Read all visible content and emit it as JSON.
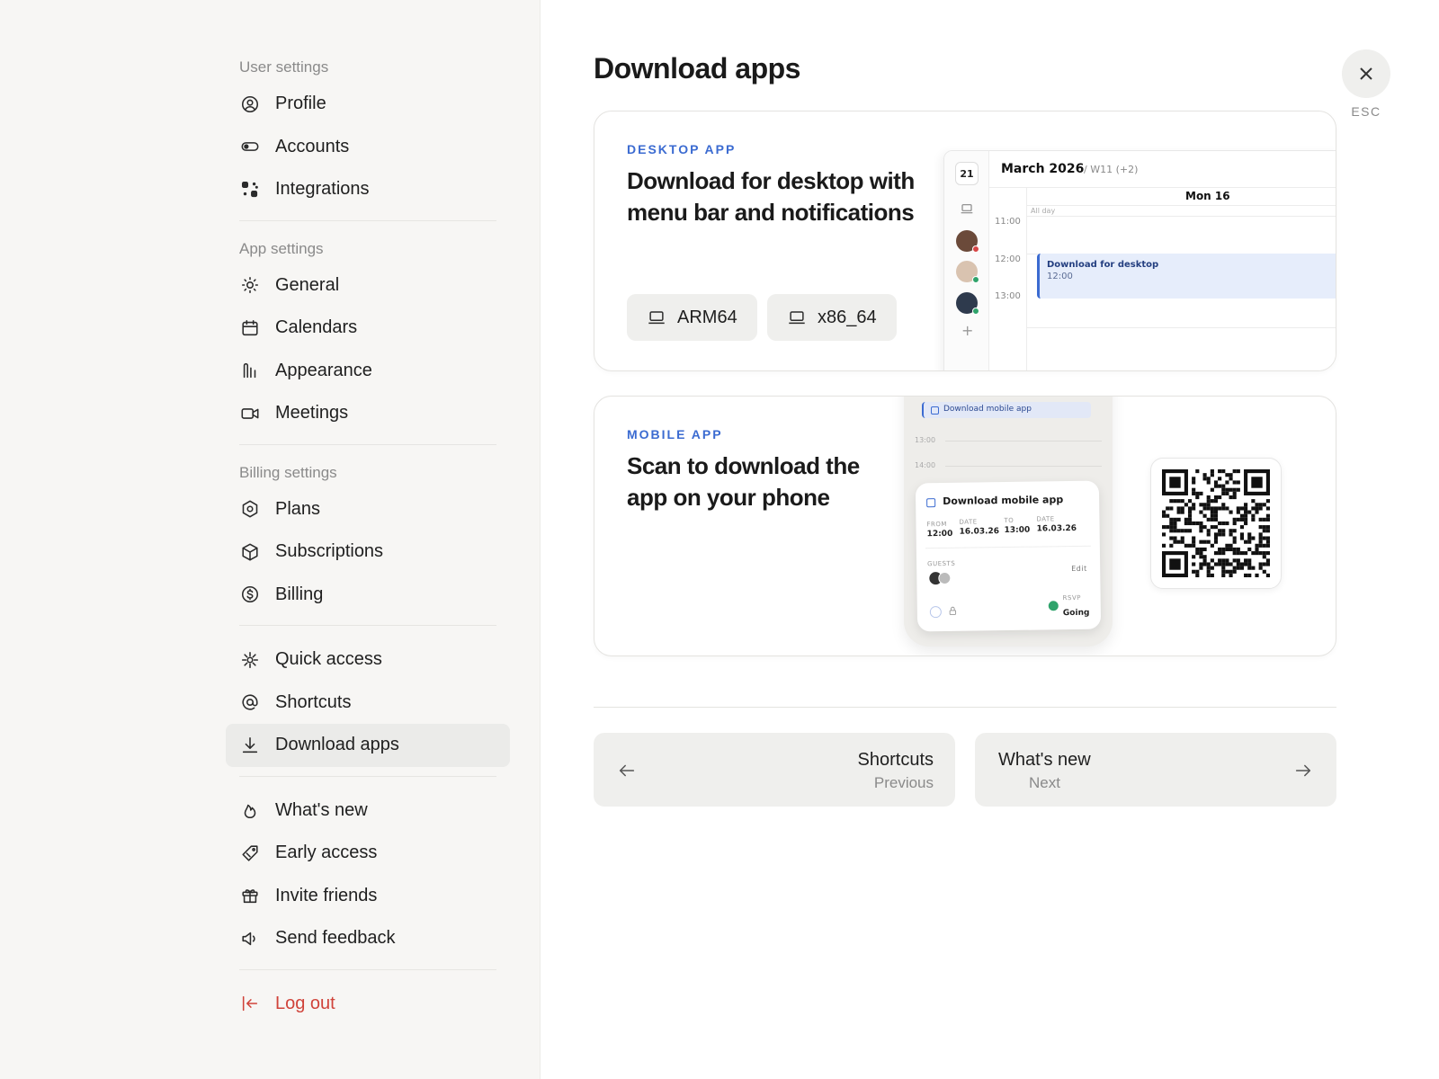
{
  "sidebar": {
    "user_settings_title": "User settings",
    "app_settings_title": "App settings",
    "billing_settings_title": "Billing settings",
    "user_items": [
      {
        "label": "Profile",
        "icon": "profile-icon"
      },
      {
        "label": "Accounts",
        "icon": "toggle-icon"
      },
      {
        "label": "Integrations",
        "icon": "integrations-icon"
      }
    ],
    "app_items": [
      {
        "label": "General",
        "icon": "sun-gear-icon"
      },
      {
        "label": "Calendars",
        "icon": "calendar-icon"
      },
      {
        "label": "Appearance",
        "icon": "appearance-icon"
      },
      {
        "label": "Meetings",
        "icon": "video-icon"
      }
    ],
    "billing_items": [
      {
        "label": "Plans",
        "icon": "hexagon-icon"
      },
      {
        "label": "Subscriptions",
        "icon": "cube-icon"
      },
      {
        "label": "Billing",
        "icon": "dollar-icon"
      }
    ],
    "misc_items": [
      {
        "label": "Quick access",
        "icon": "sparkle-icon"
      },
      {
        "label": "Shortcuts",
        "icon": "at-icon"
      },
      {
        "label": "Download apps",
        "icon": "download-icon",
        "active": true
      }
    ],
    "extra_items": [
      {
        "label": "What's new",
        "icon": "flame-icon"
      },
      {
        "label": "Early access",
        "icon": "tag-icon"
      },
      {
        "label": "Invite friends",
        "icon": "gift-icon"
      },
      {
        "label": "Send feedback",
        "icon": "megaphone-icon"
      }
    ],
    "logout_label": "Log out"
  },
  "main": {
    "title": "Download apps",
    "esc_label": "ESC",
    "desktop": {
      "eyebrow": "DESKTOP APP",
      "heading": "Download for desktop with menu bar and notifications",
      "buttons": [
        "ARM64",
        "x86_64"
      ],
      "calendar": {
        "day_badge": "21",
        "month": "March 2026",
        "week": "/ W11 (+2)",
        "day_header": "Mon 16",
        "all_day": "All day",
        "times": [
          "11:00",
          "12:00",
          "13:00"
        ],
        "event_title": "Download for desktop",
        "event_time": "12:00",
        "add_symbol": "+"
      }
    },
    "mobile": {
      "eyebrow": "MOBILE APP",
      "heading": "Scan to download the app on your phone",
      "phone": {
        "top_event": "Download mobile app",
        "times": [
          "13:00",
          "14:00"
        ],
        "sheet_title": "Download mobile app",
        "from_label": "FROM",
        "from_time": "12:00",
        "date_label": "DATE",
        "from_date": "16.03.26",
        "to_label": "TO",
        "to_time": "13:00",
        "to_date_label": "DATE",
        "to_date": "16.03.26",
        "guests_label": "GUESTS",
        "edit_label": "Edit",
        "rsvp_label": "RSVP",
        "rsvp_value": "Going"
      }
    },
    "pager": {
      "prev_title": "Shortcuts",
      "prev_sub": "Previous",
      "next_title": "What's new",
      "next_sub": "Next"
    }
  },
  "colors": {
    "accent": "#3b6bd1",
    "logout": "#d0433a",
    "sidebar_bg": "#f7f6f4",
    "going": "#2fa36b"
  }
}
